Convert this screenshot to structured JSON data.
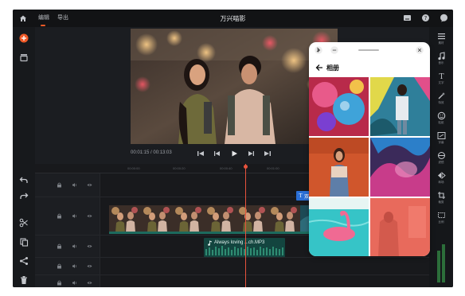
{
  "topbar": {
    "tab_edit": "编辑",
    "tab_export": "导出",
    "title": "万兴喵影"
  },
  "playback": {
    "timecode": "00:01:15 / 00:13:03"
  },
  "timeline": {
    "ruler_ticks": [
      "00:00:00",
      "00:00:20",
      "00:00:40",
      "00:01:00",
      "00:01:20"
    ],
    "text_clip_label": "双击输入",
    "audio_clip_label": "Always loving ...ch.MP3"
  },
  "right_rail": {
    "items": [
      "素材",
      "音乐",
      "文字",
      "特效",
      "贴纸",
      "字幕",
      "滤镜",
      "转场",
      "裁剪",
      "比例",
      "AI"
    ]
  },
  "album": {
    "title": "相册",
    "back_icon": "arrow-left-icon"
  },
  "colors": {
    "accent": "#f05a28",
    "playhead": "#e8533d",
    "text_clip": "#2a6fd6",
    "audio_clip": "#13453f"
  }
}
